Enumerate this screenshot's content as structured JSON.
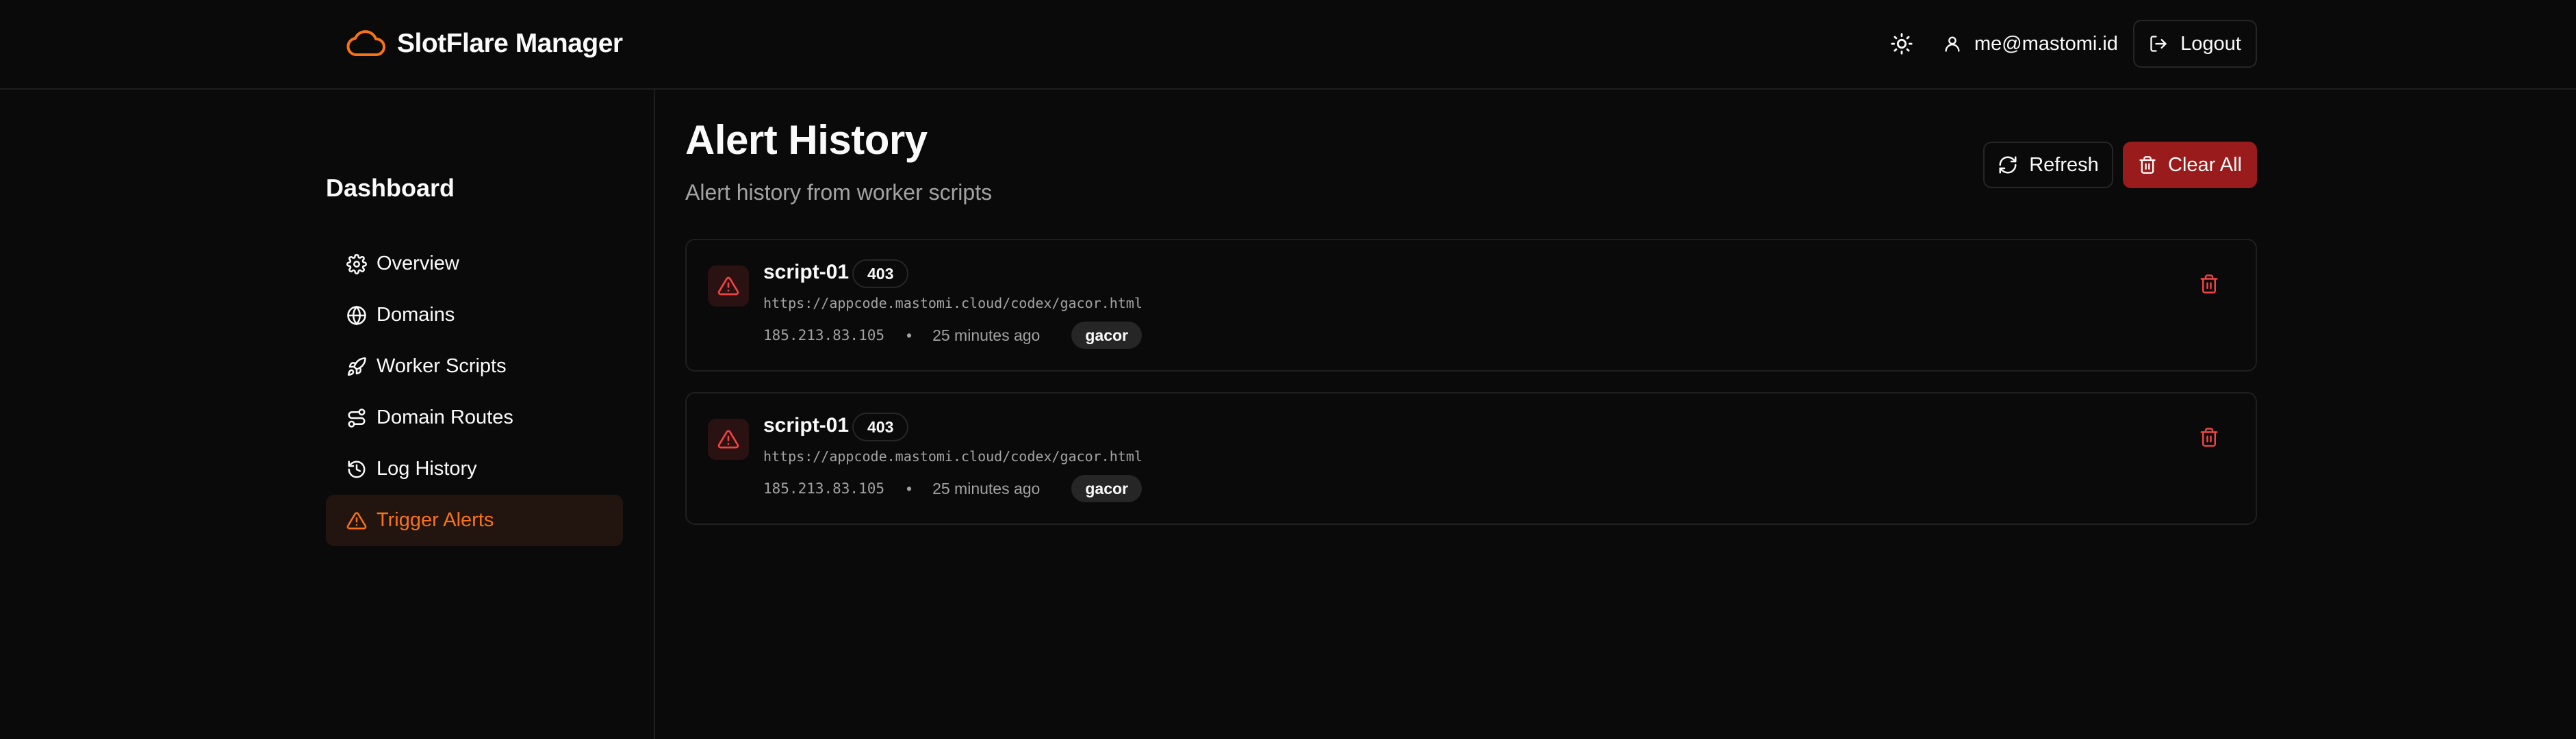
{
  "header": {
    "brand_name": "SlotFlare Manager",
    "brand_icon": "cloud-icon",
    "theme_icon": "sun-icon",
    "user_email": "me@mastomi.id",
    "logout_label": "Logout"
  },
  "sidebar": {
    "title": "Dashboard",
    "items": [
      {
        "label": "Overview",
        "icon": "gear-icon",
        "active": false
      },
      {
        "label": "Domains",
        "icon": "globe-icon",
        "active": false
      },
      {
        "label": "Worker Scripts",
        "icon": "rocket-icon",
        "active": false
      },
      {
        "label": "Domain Routes",
        "icon": "route-icon",
        "active": false
      },
      {
        "label": "Log History",
        "icon": "history-icon",
        "active": false
      },
      {
        "label": "Trigger Alerts",
        "icon": "alert-triangle-icon",
        "active": true
      }
    ]
  },
  "main": {
    "title": "Alert History",
    "subtitle": "Alert history from worker scripts",
    "refresh_label": "Refresh",
    "clear_label": "Clear All",
    "alerts": [
      {
        "script": "script-01",
        "status": "403",
        "url": "https://appcode.mastomi.cloud/codex/gacor.html",
        "ip": "185.213.83.105",
        "time": "25 minutes ago",
        "tag": "gacor"
      },
      {
        "script": "script-01",
        "status": "403",
        "url": "https://appcode.mastomi.cloud/codex/gacor.html",
        "ip": "185.213.83.105",
        "time": "25 minutes ago",
        "tag": "gacor"
      }
    ]
  },
  "colors": {
    "accent": "#f97316",
    "danger": "#991b1b",
    "background": "#0a0a0a",
    "border": "#1f1f1f"
  }
}
